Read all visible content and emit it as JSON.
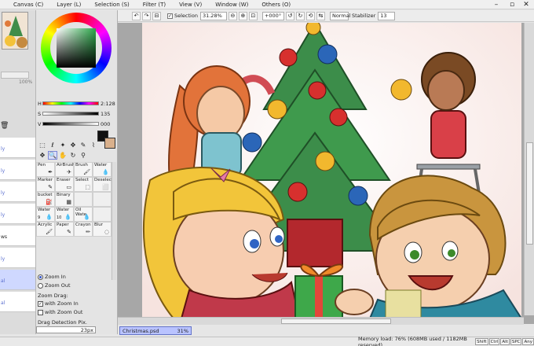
{
  "menu": [
    "Canvas (C)",
    "Layer (L)",
    "Selection (S)",
    "Filter (T)",
    "View (V)",
    "Window (W)",
    "Others (O)"
  ],
  "toolbar": {
    "selection_label": "Selection",
    "zoom": "31.28%",
    "rotation": "+000°",
    "blend_mode": "Normal",
    "stabilizer_label": "Stabilizer",
    "stabilizer_value": "13"
  },
  "color": {
    "h_label": "H",
    "h_value": "2:128",
    "s_label": "S",
    "s_value": "135",
    "v_label": "V",
    "v_value": "000",
    "foreground": "#111111",
    "background": "#d9b08c"
  },
  "brushes": [
    {
      "label": "Pen",
      "icon": "pen-icon",
      "num": ""
    },
    {
      "label": "AirBrush",
      "icon": "airbrush-icon",
      "num": ""
    },
    {
      "label": "Brush",
      "icon": "brush-icon",
      "num": ""
    },
    {
      "label": "Water",
      "icon": "water-icon",
      "num": ""
    },
    {
      "label": "Marker",
      "icon": "marker-icon",
      "num": ""
    },
    {
      "label": "Eraser",
      "icon": "eraser-icon",
      "num": ""
    },
    {
      "label": "Select",
      "icon": "select-icon",
      "num": ""
    },
    {
      "label": "Deselect",
      "icon": "deselect-icon",
      "num": ""
    },
    {
      "label": "bucket",
      "icon": "bucket-icon",
      "num": ""
    },
    {
      "label": "Binary",
      "icon": "binary-icon",
      "num": ""
    },
    {
      "label": "",
      "icon": "",
      "num": ""
    },
    {
      "label": "",
      "icon": "",
      "num": ""
    },
    {
      "label": "Water",
      "icon": "water-icon",
      "num": "9"
    },
    {
      "label": "Water",
      "icon": "water-icon",
      "num": "10"
    },
    {
      "label": "Oil Wate",
      "icon": "oil-water-icon",
      "num": ""
    },
    {
      "label": "",
      "icon": "",
      "num": ""
    },
    {
      "label": "Acrylic",
      "icon": "acrylic-icon",
      "num": ""
    },
    {
      "label": "Paper",
      "icon": "paper-icon",
      "num": ""
    },
    {
      "label": "Crayon",
      "icon": "crayon-icon",
      "num": ""
    },
    {
      "label": "Blur",
      "icon": "blur-icon",
      "num": ""
    }
  ],
  "options": {
    "zoom_in": "Zoom In",
    "zoom_out": "Zoom Out",
    "zoom_drag": "Zoom Drag:",
    "with_zoom_in": "with Zoom In",
    "with_zoom_out": "with Zoom Out",
    "drag_detection": "Drag Detection Pix.",
    "drag_value": "23px"
  },
  "left": {
    "percent": "100%",
    "row_labels": [
      "ly",
      "ly",
      "ly",
      "ly",
      "ly",
      "ws",
      "ly",
      "al",
      "al"
    ]
  },
  "document": {
    "name": "Christmas.psd",
    "zoom": "31%"
  },
  "status": {
    "memory": "Memory load: 76% (608MB used / 1182MB reserved)",
    "keys": [
      "Shift",
      "Ctrl",
      "Alt",
      "SPC",
      "Any"
    ]
  }
}
